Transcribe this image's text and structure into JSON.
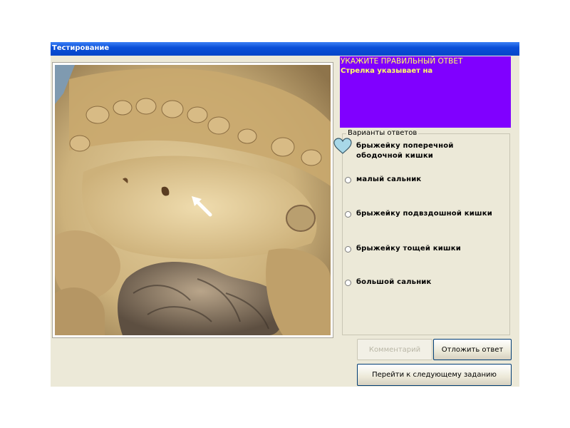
{
  "window": {
    "title": "Тестирование"
  },
  "question": {
    "header": "УКАЖИТЕ ПРАВИЛЬНЫЙ ОТВЕТ",
    "text": "Стрелка указывает на"
  },
  "answers": {
    "legend": "Варианты ответов",
    "options": [
      {
        "label": "брыжейку поперечной ободочной кишки",
        "selected": true
      },
      {
        "label": "малый сальник",
        "selected": false
      },
      {
        "label": "брыжейку подвздошной кишки",
        "selected": false
      },
      {
        "label": "брыжейку тощей кишки",
        "selected": false
      },
      {
        "label": "большой сальник",
        "selected": false
      }
    ]
  },
  "buttons": {
    "comment": "Комментарий",
    "postpone": "Отложить ответ",
    "next": "Перейти к следующему заданию"
  },
  "colors": {
    "titlebar": "#0a4fd8",
    "question_bg": "#8000ff",
    "question_text": "#ffff66",
    "window_bg": "#ece9d8"
  },
  "icons": {
    "selection_marker": "heart-icon",
    "pointer": "arrow-icon"
  }
}
